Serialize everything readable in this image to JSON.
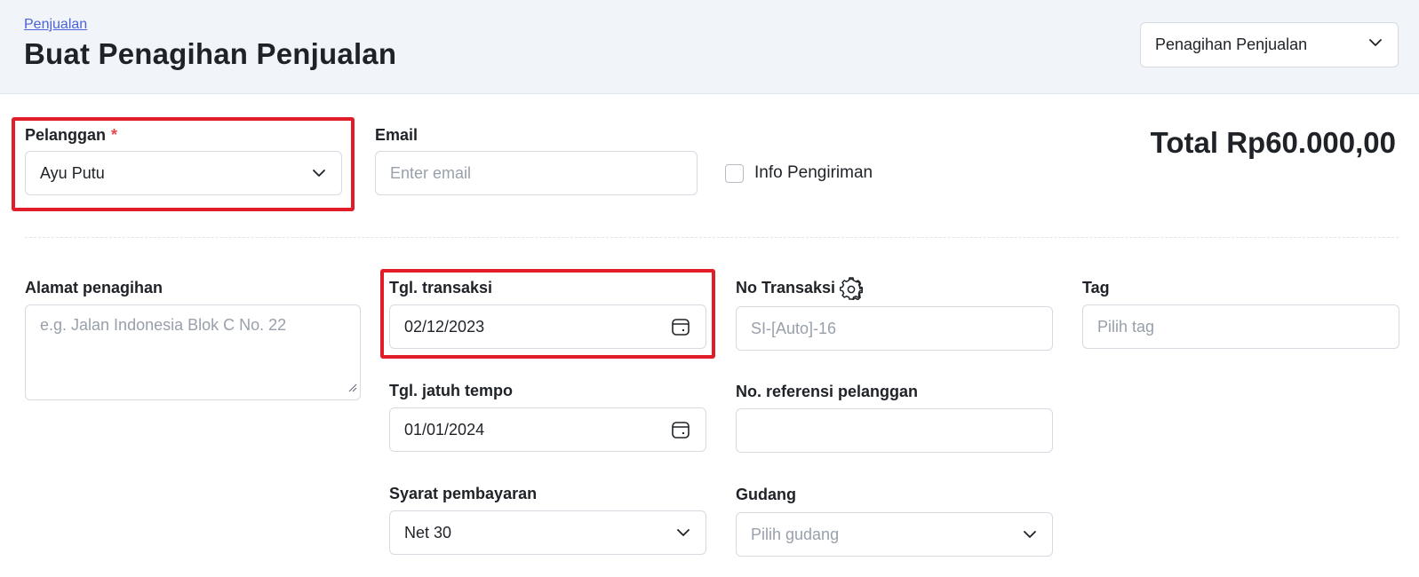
{
  "header": {
    "breadcrumb": "Penjualan",
    "title": "Buat Penagihan Penjualan",
    "document_type": {
      "value": "Penagihan Penjualan",
      "icon": "chevron-down-icon"
    }
  },
  "customer": {
    "label": "Pelanggan",
    "required_mark": "*",
    "value": "Ayu Putu"
  },
  "email": {
    "label": "Email",
    "placeholder": "Enter email"
  },
  "shipping_info": {
    "label": "Info Pengiriman",
    "checked": false
  },
  "total": {
    "text": "Total Rp60.000,00"
  },
  "billing_address": {
    "label": "Alamat penagihan",
    "placeholder": "e.g. Jalan Indonesia Blok C No. 22"
  },
  "transaction_date": {
    "label": "Tgl. transaksi",
    "value": "02/12/2023",
    "icon": "calendar-icon"
  },
  "due_date": {
    "label": "Tgl. jatuh tempo",
    "value": "01/01/2024",
    "icon": "calendar-icon"
  },
  "payment_terms": {
    "label": "Syarat pembayaran",
    "value": "Net 30"
  },
  "transaction_no": {
    "label": "No Transaksi",
    "placeholder": "SI-[Auto]-16",
    "icon": "gear-icon"
  },
  "customer_ref": {
    "label": "No. referensi pelanggan",
    "value": ""
  },
  "warehouse": {
    "label": "Gudang",
    "placeholder": "Pilih gudang"
  },
  "tag": {
    "label": "Tag",
    "placeholder": "Pilih tag"
  },
  "colors": {
    "highlight": "#e11d2a",
    "link": "#4b63d8",
    "required": "#e5484d"
  }
}
